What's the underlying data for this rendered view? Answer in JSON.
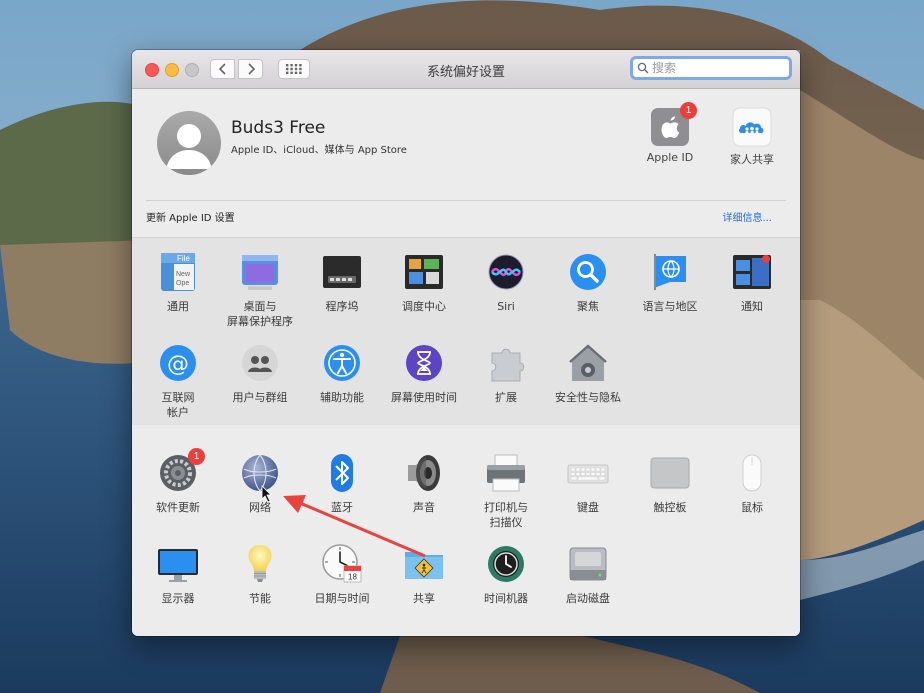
{
  "window": {
    "title": "系统偏好设置",
    "search_placeholder": "搜索"
  },
  "account": {
    "name": "Buds3 Free",
    "subtitle": "Apple ID、iCloud、媒体与 App Store",
    "apple_id_label": "Apple ID",
    "apple_id_badge": "1",
    "family_label": "家人共享",
    "update_text": "更新 Apple ID 设置",
    "details_link": "详细信息..."
  },
  "panes_row1": [
    {
      "label": "通用",
      "icon": "general-icon"
    },
    {
      "label": "桌面与\n屏幕保护程序",
      "icon": "desktop-icon"
    },
    {
      "label": "程序坞",
      "icon": "dock-icon"
    },
    {
      "label": "调度中心",
      "icon": "mission-control-icon"
    },
    {
      "label": "Siri",
      "icon": "siri-icon"
    },
    {
      "label": "聚焦",
      "icon": "spotlight-icon"
    },
    {
      "label": "语言与地区",
      "icon": "language-icon"
    },
    {
      "label": "通知",
      "icon": "notifications-icon"
    }
  ],
  "panes_row2": [
    {
      "label": "互联网\n帐户",
      "icon": "internet-accounts-icon"
    },
    {
      "label": "用户与群组",
      "icon": "users-icon"
    },
    {
      "label": "辅助功能",
      "icon": "accessibility-icon"
    },
    {
      "label": "屏幕使用时间",
      "icon": "screen-time-icon"
    },
    {
      "label": "扩展",
      "icon": "extensions-icon"
    },
    {
      "label": "安全性与隐私",
      "icon": "security-icon"
    }
  ],
  "panes_row3": [
    {
      "label": "软件更新",
      "icon": "software-update-icon",
      "badge": "1"
    },
    {
      "label": "网络",
      "icon": "network-icon"
    },
    {
      "label": "蓝牙",
      "icon": "bluetooth-icon"
    },
    {
      "label": "声音",
      "icon": "sound-icon"
    },
    {
      "label": "打印机与\n扫描仪",
      "icon": "printer-icon"
    },
    {
      "label": "键盘",
      "icon": "keyboard-icon"
    },
    {
      "label": "触控板",
      "icon": "trackpad-icon"
    },
    {
      "label": "鼠标",
      "icon": "mouse-icon"
    }
  ],
  "panes_row4": [
    {
      "label": "显示器",
      "icon": "display-icon"
    },
    {
      "label": "节能",
      "icon": "energy-saver-icon"
    },
    {
      "label": "日期与时间",
      "icon": "date-time-icon"
    },
    {
      "label": "共享",
      "icon": "sharing-icon"
    },
    {
      "label": "时间机器",
      "icon": "time-machine-icon"
    },
    {
      "label": "启动磁盘",
      "icon": "startup-disk-icon"
    }
  ],
  "colors": {
    "accent": "#1f6fd9",
    "badge": "#ee3d3a",
    "annotation_arrow": "#e8433f"
  }
}
